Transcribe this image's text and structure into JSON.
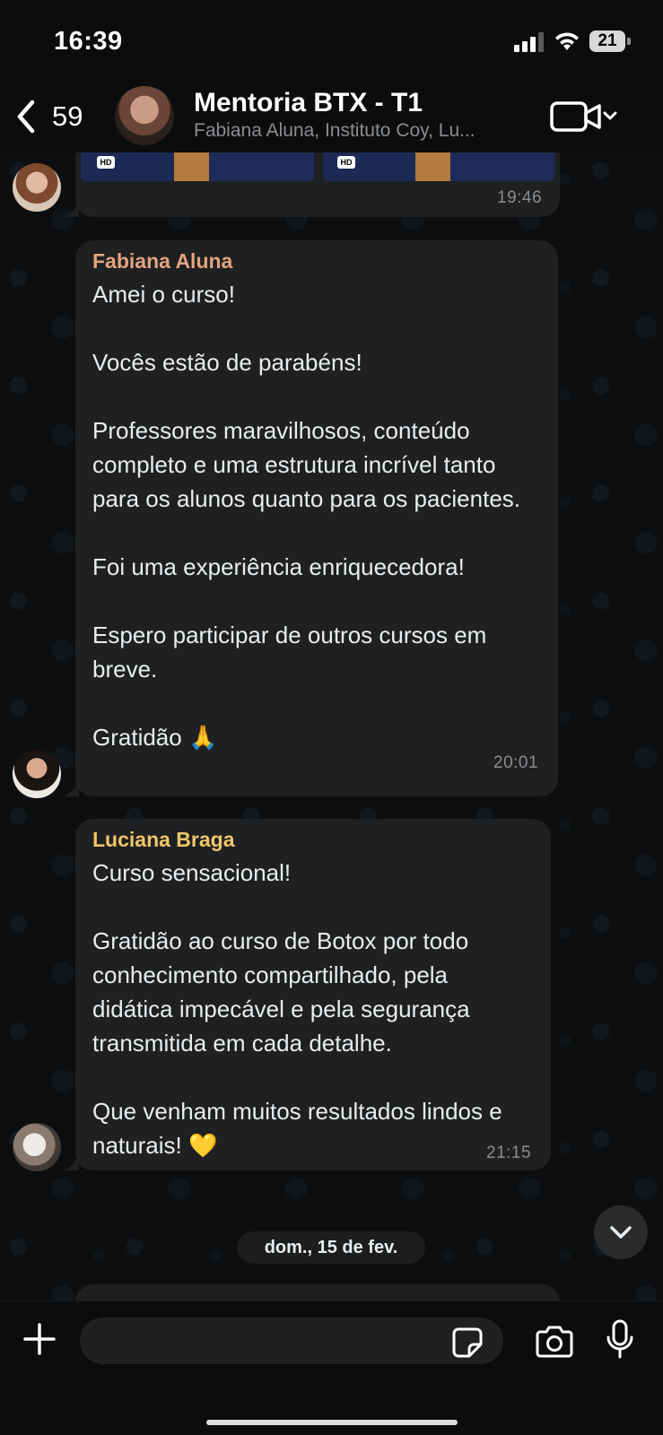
{
  "status_bar": {
    "time": "16:39",
    "battery": "21"
  },
  "header": {
    "back_count": "59",
    "title": "Mentoria BTX - T1",
    "subtitle": "Fabiana Aluna, Instituto Coy, Lu..."
  },
  "messages": [
    {
      "time": "19:46"
    },
    {
      "sender": "Fabiana Aluna",
      "sender_color": "#e3a47e",
      "text": "Amei o curso!\n\nVocês estão de parabéns!\n\nProfessores maravilhosos, conteúdo completo e uma estrutura incrível tanto para os alunos quanto para os pacientes.\n\nFoi uma experiência enriquecedora!\n\nEspero participar de outros cursos em breve.\n\nGratidão 🙏",
      "time": "20:01"
    },
    {
      "sender": "Luciana Braga",
      "sender_color": "#f0c66a",
      "text": "Curso sensacional!\n\nGratidão ao curso de Botox por todo conhecimento compartilhado, pela didática impecável e pela segurança transmitida em cada detalhe.\n\nQue venham muitos resultados lindos e naturais! 💛",
      "time": "21:15"
    }
  ],
  "date_separator": "dom., 15 de fev.",
  "composer": {
    "placeholder": ""
  },
  "colors": {
    "bubble": "#1f2021",
    "background": "#0c0d0e",
    "accent_fabiana": "#e3a47e",
    "accent_luciana": "#f0c66a"
  }
}
